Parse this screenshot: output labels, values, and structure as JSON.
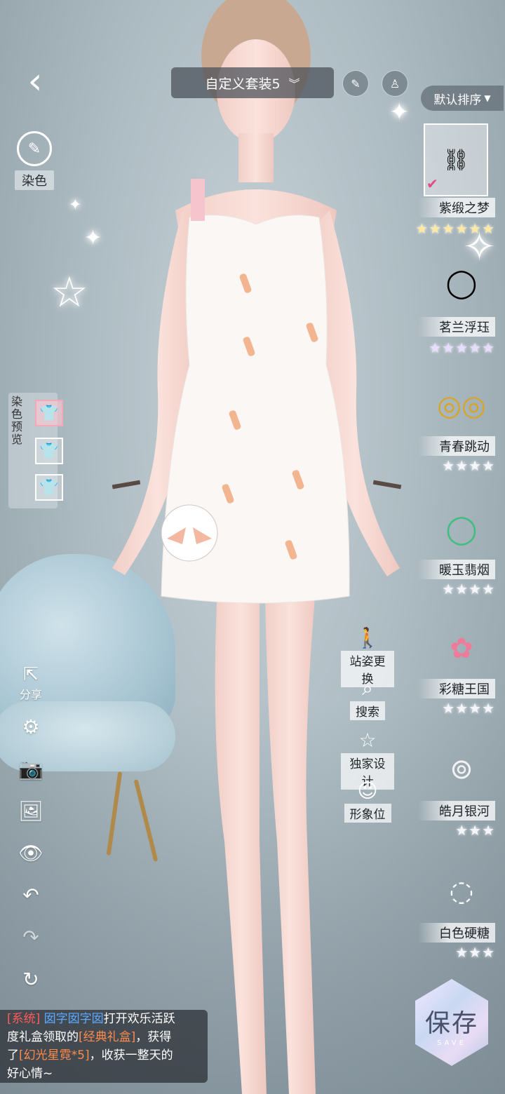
{
  "header": {
    "outfit_name": "自定义套装5",
    "sort_label": "默认排序"
  },
  "left_panel": {
    "dye_label": "染色",
    "dye_preview_label": "染色预览",
    "share_label": "分享"
  },
  "middle_actions": {
    "pose": "站姿更换",
    "search": "搜索",
    "exclusive": "独家设计",
    "image_slot": "形象位"
  },
  "accessories": [
    {
      "name": "紫缎之梦",
      "stars": "★★★★★★"
    },
    {
      "name": "茗兰浮珏",
      "stars": "★★★★★"
    },
    {
      "name": "青春跳动",
      "stars": "★★★★"
    },
    {
      "name": "暖玉翡烟",
      "stars": "★★★★"
    },
    {
      "name": "彩糖王国",
      "stars": "★★★★"
    },
    {
      "name": "皓月银河",
      "stars": "★★★"
    },
    {
      "name": "白色硬糖",
      "stars": "★★★"
    }
  ],
  "chat": {
    "tag": "[系统]",
    "user": "囡字囡字囡",
    "line1": "打开欢乐活跃",
    "line2a": "度礼盒领取的",
    "item1": "[经典礼盒]",
    "line2b": "，获得",
    "line3a": "了",
    "item2": "[幻光星霓*5]",
    "line3b": "，收获一整天的",
    "line4": "好心情~"
  },
  "save": {
    "label": "保存",
    "sub": "SAVE"
  }
}
